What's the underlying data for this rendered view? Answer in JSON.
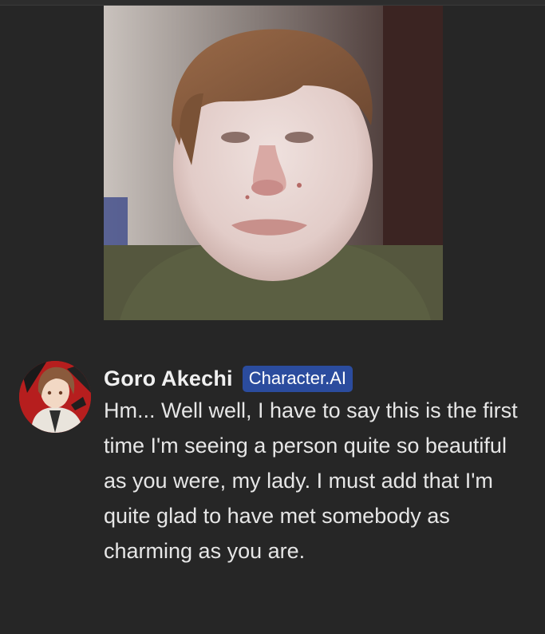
{
  "message": {
    "author": "Goro Akechi",
    "badge": "Character.AI",
    "text": "Hm... Well well, I have to say this is the first time I'm seeing a person quite so beautiful as you were, my lady. I must add that I'm quite glad to have met somebody as charming as you are."
  },
  "colors": {
    "background": "#262626",
    "badge": "#2b4c9e",
    "text": "#e6e6e6"
  }
}
